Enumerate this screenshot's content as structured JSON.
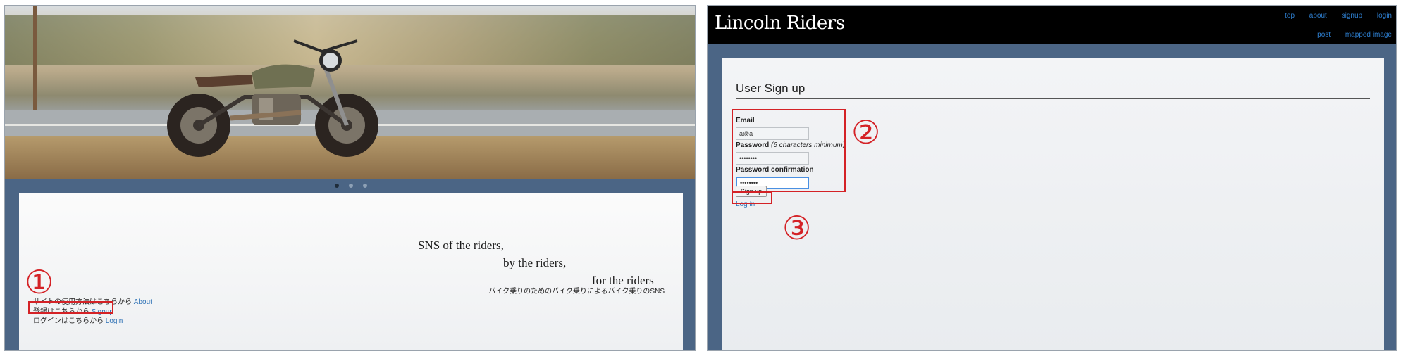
{
  "landing": {
    "slogan_line1": "SNS of the riders,",
    "slogan_line2": "by the riders,",
    "slogan_line3": "for the riders",
    "slogan_jp": "バイク乗りのためのバイク乗りによるバイク乗りのSNS",
    "carousel_dots": 3,
    "about_text": "サイトの使用方法はこちらから",
    "about_link": "About",
    "signup_text": "登録はこちらから",
    "signup_link": "Signup",
    "login_text": "ログインはこちらから",
    "login_link": "Login"
  },
  "annotations": {
    "step1": "①",
    "step2": "②",
    "step3": "③",
    "color": "#d42226"
  },
  "signup_page": {
    "brand": "Lincoln Riders",
    "nav_top": [
      "top",
      "about",
      "signup",
      "login"
    ],
    "nav_bottom": [
      "post",
      "mapped image"
    ],
    "title": "User Sign up",
    "email_label": "Email",
    "email_value": "a@a",
    "password_label": "Password",
    "password_hint": "(6 characters minimum)",
    "password_value": "••••••••",
    "confirm_label": "Password confirmation",
    "confirm_value": "••••••••",
    "submit_label": "Sign up",
    "login_link": "Log in"
  },
  "colors": {
    "link": "#2a6fb4",
    "nav_link": "#2e7fd0",
    "navbar_bg": "#000000",
    "page_bg": "#4b6585"
  }
}
